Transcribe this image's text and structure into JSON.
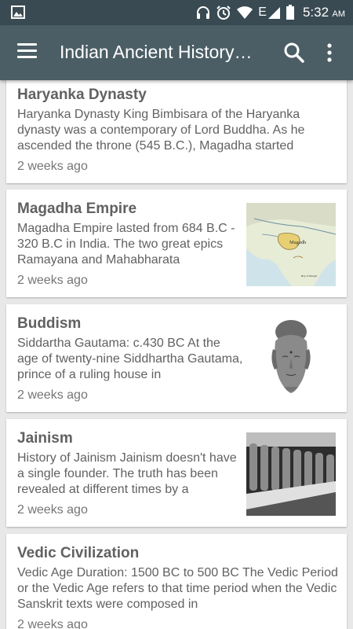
{
  "status_bar": {
    "time": "5:32",
    "ampm": "AM",
    "network": "E",
    "icons": [
      "picture-icon",
      "headset-icon",
      "alarm-icon",
      "wifi-icon",
      "signal-icon",
      "battery-icon"
    ]
  },
  "app_bar": {
    "title": "Indian Ancient History…",
    "icons": [
      "menu-icon",
      "search-icon",
      "more-vert-icon"
    ]
  },
  "articles": [
    {
      "title": "Haryanka Dynasty",
      "description": "Haryanka Dynasty King Bimbisara of the Haryanka dynasty was a contemporary of Lord Buddha. As he ascended the throne (545 B.C.), Magadha started",
      "date": "2 weeks ago"
    },
    {
      "title": "Magadha Empire",
      "description": "Magadha Empire lasted from 684 B.C - 320 B.C in India. The two great epics Ramayana and Mahabharata",
      "date": "2 weeks ago",
      "map_label": "Magadh",
      "map_small_label": "Bay of Bengal"
    },
    {
      "title": "Buddism",
      "description": "Siddartha Gautama: c.430 BC At the age of twenty-nine Siddhartha Gautama, prince of a ruling house in",
      "date": "2 weeks ago"
    },
    {
      "title": "Jainism",
      "description": "History of Jainism Jainism doesn't have a single founder. The truth has been revealed at different times by a",
      "date": "2 weeks ago"
    },
    {
      "title": "Vedic Civilization",
      "description": "Vedic Age Duration:  1500 BC to 500 BC The Vedic Period or the Vedic Age refers to that time period when the Vedic Sanskrit texts were composed in",
      "date": "2 weeks ago"
    }
  ]
}
